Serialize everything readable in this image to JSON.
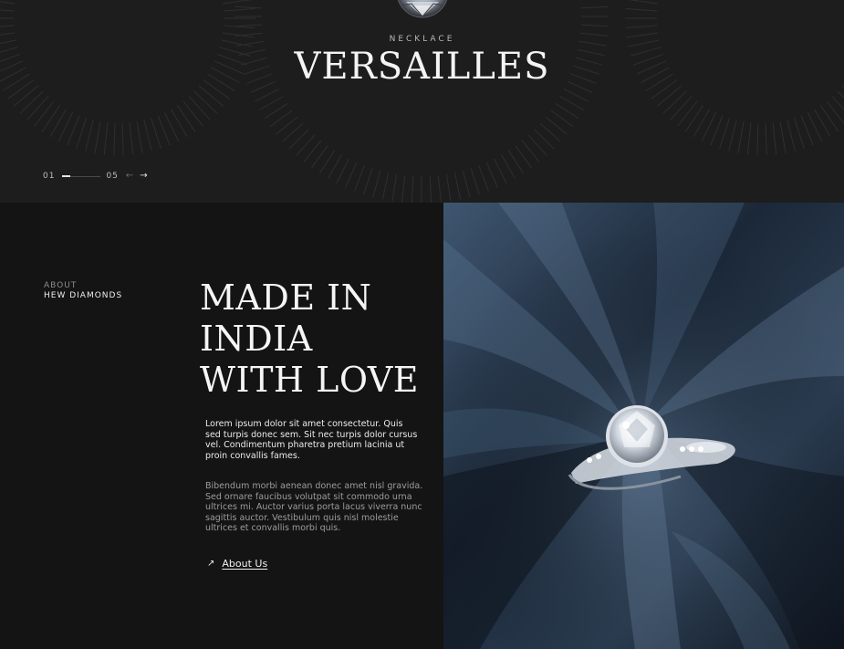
{
  "hero": {
    "eyebrow": "NECKLACE",
    "title": "VERSAILLES",
    "slider": {
      "current": "01",
      "total": "05",
      "progress": 0.2,
      "prev_icon": "arrow-left-icon",
      "next_icon": "arrow-right-icon"
    }
  },
  "about": {
    "kicker_top": "ABOUT",
    "kicker_bottom": "HEW DIAMONDS",
    "heading_lines": [
      "MADE IN",
      "INDIA",
      "WITH LOVE"
    ],
    "paragraph_1": "Lorem ipsum dolor sit amet consectetur. Quis sed turpis donec sem. Sit nec turpis dolor cursus vel. Condimentum pharetra pretium lacinia ut proin convallis fames.",
    "paragraph_2": "Bibendum morbi aenean donec amet nisl gravida. Sed ornare faucibus volutpat sit commodo urna ultrices mi. Auctor varius porta lacus viverra nunc sagittis auctor. Vestibulum quis nisl molestie ultrices et convallis morbi quis.",
    "link_label": "About Us",
    "link_icon": "arrow-up-right-icon",
    "image": "diamond-ring-on-silk-image"
  },
  "colors": {
    "hero_bg": "#1d1d1e",
    "section_bg": "#141414",
    "text": "#f4f4f4",
    "muted": "#9d9d9d",
    "silk": "#1e2c3c"
  }
}
